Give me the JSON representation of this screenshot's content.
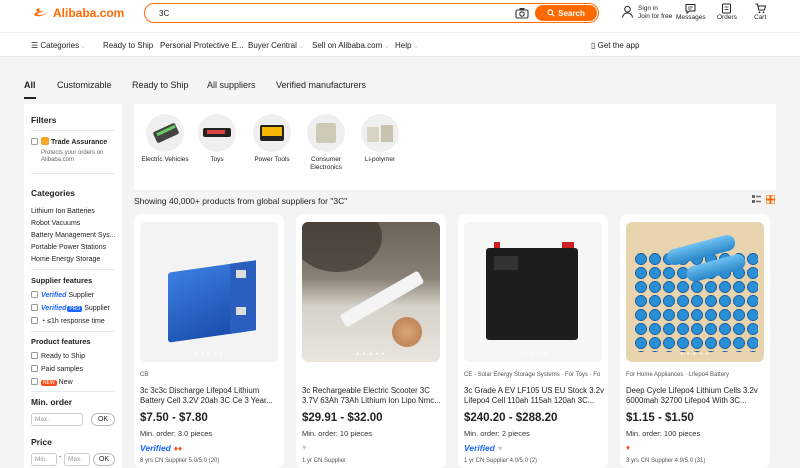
{
  "header": {
    "logo_text": "Alibaba.com",
    "search_value": "3C",
    "search_button": "Search",
    "signin_line1": "Sign in",
    "signin_line2": "Join for free",
    "messages": "Messages",
    "orders": "Orders",
    "cart": "Cart",
    "accent": "#ff6a00"
  },
  "nav": {
    "categories": "Categories",
    "ready": "Ready to Ship",
    "ppe": "Personal Protective E...",
    "buyer": "Buyer Central",
    "sell": "Sell on Alibaba.com",
    "help": "Help",
    "app": "Get the app"
  },
  "tabs": [
    "All",
    "Customizable",
    "Ready to Ship",
    "All suppliers",
    "Verified manufacturers"
  ],
  "filters": {
    "title": "Filters",
    "trade_title": "Trade Assurance",
    "trade_desc1": "Protects your orders on",
    "trade_desc2": "Alibaba.com",
    "categories_title": "Categories",
    "categories": [
      "Lithium Ion Batteries",
      "Robot Vacuums",
      "Battery Management Sys...",
      "Portable Power Stations",
      "Home Energy Storage"
    ],
    "supplier_title": "Supplier features",
    "supplier_verified": "Verified",
    "supplier_supplier": "Supplier",
    "supplier_pro": "Verified",
    "supplier_pro_tag": "PRO",
    "supplier_pro_supplier": "Supplier",
    "response": "≤1h response time",
    "product_title": "Product features",
    "ready_ship": "Ready to Ship",
    "paid": "Paid samples",
    "new_tag": "NEW",
    "new_label": "New",
    "minorder_title": "Min. order",
    "min_placeholder": "Max.",
    "ok": "OK",
    "price_title": "Price",
    "price_min": "Min.",
    "price_dash": "-",
    "price_max": "Max.",
    "ok2": "OK"
  },
  "categories_strip": [
    {
      "label": "Electric Vehicles",
      "icon": "scooter-battery-icon"
    },
    {
      "label": "Toys",
      "icon": "rc-battery-icon"
    },
    {
      "label": "Power Tools",
      "icon": "tool-battery-icon"
    },
    {
      "label": "Consumer Electronics",
      "icon": "pouch-cell-icon"
    },
    {
      "label": "Li-polymer",
      "icon": "polymer-cell-icon"
    }
  ],
  "showing": "Showing 40,000+ products from global suppliers for \"3C\"",
  "products": [
    {
      "tag": "CB",
      "title": "3c 3c3c Discharge Lifepo4 Lithium Battery Cell 3.2V 20ah 3C Ce 3 Year...",
      "price": "$7.50 - $7.80",
      "min_order": "Min. order: 3.0 pieces",
      "verified": "Verified",
      "supplier": "8 yrs  CN Supplier  5.0/5.0 (20)"
    },
    {
      "tag": "",
      "title": "3c Rechargeable Electric Scooter 3C 3.7V 63Ah 73Ah Lithium Ion Lipo Nmc...",
      "price": "$29.91 - $32.00",
      "min_order": "Min. order: 10 pieces",
      "verified": "",
      "supplier": "1 yr  CN Supplier"
    },
    {
      "tag": "CE · Solar Energy Storage Systems · For Toys · Fo",
      "title": "3c Grade A EV LF105 US EU Stock 3.2v Lifepo4 Cell 110ah 115ah 120ah 3C...",
      "price": "$240.20 - $288.20",
      "min_order": "Min. order: 2 pieces",
      "verified": "Verified",
      "supplier": "1 yr  CN Supplier  4.0/5.0 (2)"
    },
    {
      "tag": "For Home Appliances · Lifepo4 Battery",
      "title": "Deep Cycle Lifepo4 Lithium Cells 3.2v 6000mah 32700 Lifepo4 With 3C...",
      "price": "$1.15 - $1.50",
      "min_order": "Min. order: 100 pieces",
      "verified": "",
      "supplier": "3 yrs  CN Supplier  4.9/5.0 (31)"
    }
  ]
}
